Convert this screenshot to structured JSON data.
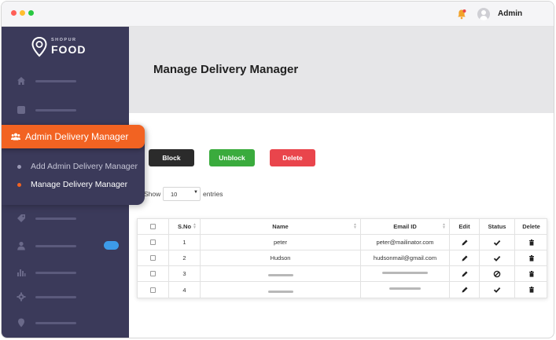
{
  "topbar": {
    "admin_name": "Admin",
    "icons": [
      "bell-icon",
      "user-avatar-icon"
    ]
  },
  "brand": {
    "small": "SHOPUR",
    "big": "FOOD"
  },
  "sidebar": {
    "icons": [
      "home-icon",
      "square-icon",
      "tag-icon",
      "user-icon",
      "chart-icon",
      "gear-icon",
      "location-icon"
    ],
    "active_menu": {
      "label": "Admin Delivery Manager",
      "icon": "users-icon"
    },
    "submenu": [
      {
        "label": "Add Admin Delivery Manager",
        "active": false
      },
      {
        "label": "Manage Delivery Manager",
        "active": true
      }
    ]
  },
  "page": {
    "title": "Manage Delivery Manager"
  },
  "actions": {
    "block": "Block",
    "unblock": "Unblock",
    "delete": "Delete"
  },
  "show": {
    "prefix": "Show",
    "value": "10",
    "suffix": "entries"
  },
  "table": {
    "headers": {
      "sno": "S.No",
      "name": "Name",
      "email": "Email ID",
      "edit": "Edit",
      "status": "Status",
      "delete": "Delete"
    },
    "rows": [
      {
        "sno": "1",
        "name": "peter",
        "email": "peter@mailinator.com",
        "status": "check"
      },
      {
        "sno": "2",
        "name": "Hudson",
        "email": "hudsonmail@gmail.com",
        "status": "check"
      },
      {
        "sno": "3",
        "name": "",
        "email": "",
        "status": "blocked"
      },
      {
        "sno": "4",
        "name": "",
        "email": "",
        "status": "check"
      }
    ]
  },
  "colors": {
    "accent": "#f26322",
    "sidebar": "#3b3a5a",
    "block": "#2b2b2b",
    "unblock": "#3aab3d",
    "delete": "#e9454c",
    "toggle": "#3d9be9"
  }
}
